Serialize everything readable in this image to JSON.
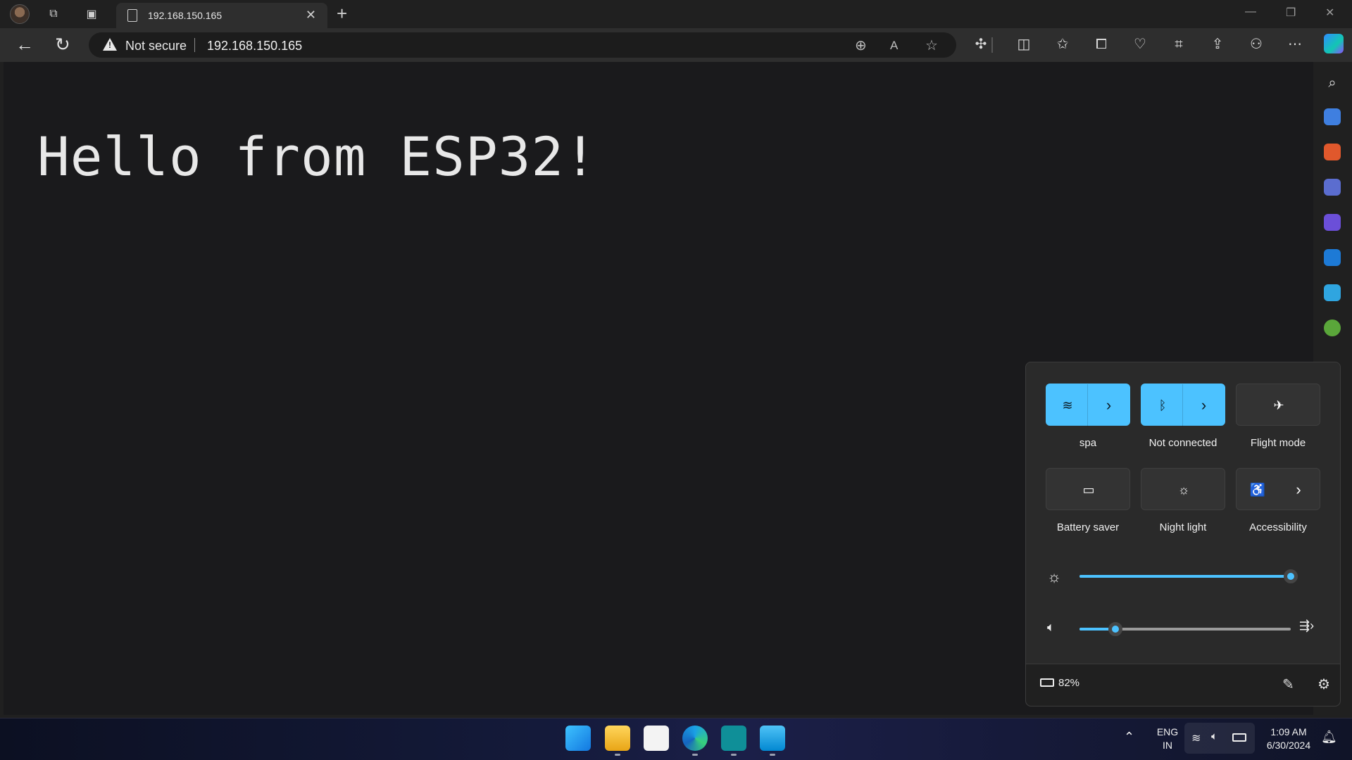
{
  "browser": {
    "tab": {
      "title": "192.168.150.165"
    },
    "address": {
      "security_label": "Not secure",
      "url": "192.168.150.165"
    }
  },
  "page": {
    "headline": "Hello from ESP32!"
  },
  "quick_settings": {
    "tiles": [
      {
        "label": "spa",
        "icon": "wifi-icon",
        "active": true,
        "has_chevron": true
      },
      {
        "label": "Not connected",
        "icon": "bluetooth-icon",
        "active": true,
        "has_chevron": true
      },
      {
        "label": "Flight mode",
        "icon": "airplane-icon",
        "active": false,
        "has_chevron": false
      },
      {
        "label": "Battery saver",
        "icon": "battery-saver-icon",
        "active": false,
        "has_chevron": false
      },
      {
        "label": "Night light",
        "icon": "night-light-icon",
        "active": false,
        "has_chevron": false
      },
      {
        "label": "Accessibility",
        "icon": "accessibility-icon",
        "active": false,
        "has_chevron": true
      }
    ],
    "brightness_level": 1.0,
    "volume_level": 0.17,
    "battery_percent": "82%"
  },
  "taskbar": {
    "apps": [
      "start-icon",
      "file-explorer-icon",
      "store-icon",
      "edge-icon",
      "arduino-icon",
      "notepad-icon"
    ],
    "language": {
      "line1": "ENG",
      "line2": "IN"
    },
    "clock": {
      "time": "1:09 AM",
      "date": "6/30/2024"
    }
  },
  "colors": {
    "accent": "#4cc2ff",
    "page_bg": "#1a1a1c",
    "panel_bg": "#2a2a2a"
  }
}
